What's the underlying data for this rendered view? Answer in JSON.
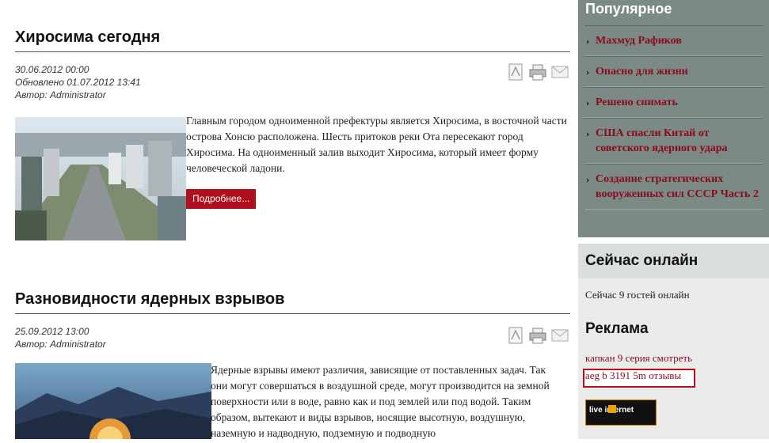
{
  "articles": [
    {
      "title": "Хиросима сегодня",
      "date": "30.06.2012 00:00",
      "updated": "Обновлено 01.07.2012 13:41",
      "author": "Автор: Administrator",
      "text": "Главным городом одноименной префектуры является Хиросима, в восточной части острова Хонсю расположена. Шесть притоков реки Ота пересекают город Хиросима. На одноименный залив выходит Хиросима, который имеет форму человеческой ладони.",
      "readmore": "Подробнее..."
    },
    {
      "title": "Разновидности ядерных взрывов",
      "date": "25.09.2012 13:00",
      "author": "Автор: Administrator",
      "text": "Ядерные взрывы имеют различия, зависящие от поставленных задач. Так они могут совершаться в воздушной среде, могут производится на земной поверхности или в воде, равно как и  под землей или под водой. Таким образом, вытекают и виды взрывов, носящие высотную, воздушную, наземную  и  надводную, подземную и подводную"
    }
  ],
  "tool_icons": [
    "pdf-icon",
    "print-icon",
    "email-icon"
  ],
  "sidebar": {
    "popular_title": "Популярное",
    "popular_items": [
      "Махмуд Рафиков",
      "Опасно для жизни",
      "Решено снимать",
      "США спасли Китай от советского ядерного удара",
      "Создание стратегических вооруженных сил СССР Часть 2"
    ],
    "online_title": "Сейчас онлайн",
    "online_text": "Сейчас 9 гостей онлайн",
    "ads_title": "Реклама",
    "ad_links": [
      "капкан 9 серия смотреть",
      "aeg b 3191 5m отзывы"
    ],
    "counter_label": "live internet"
  },
  "colors": {
    "accent": "#b0101e",
    "link": "#8a0a1e",
    "sidebar_bg": "#7c8a86"
  }
}
